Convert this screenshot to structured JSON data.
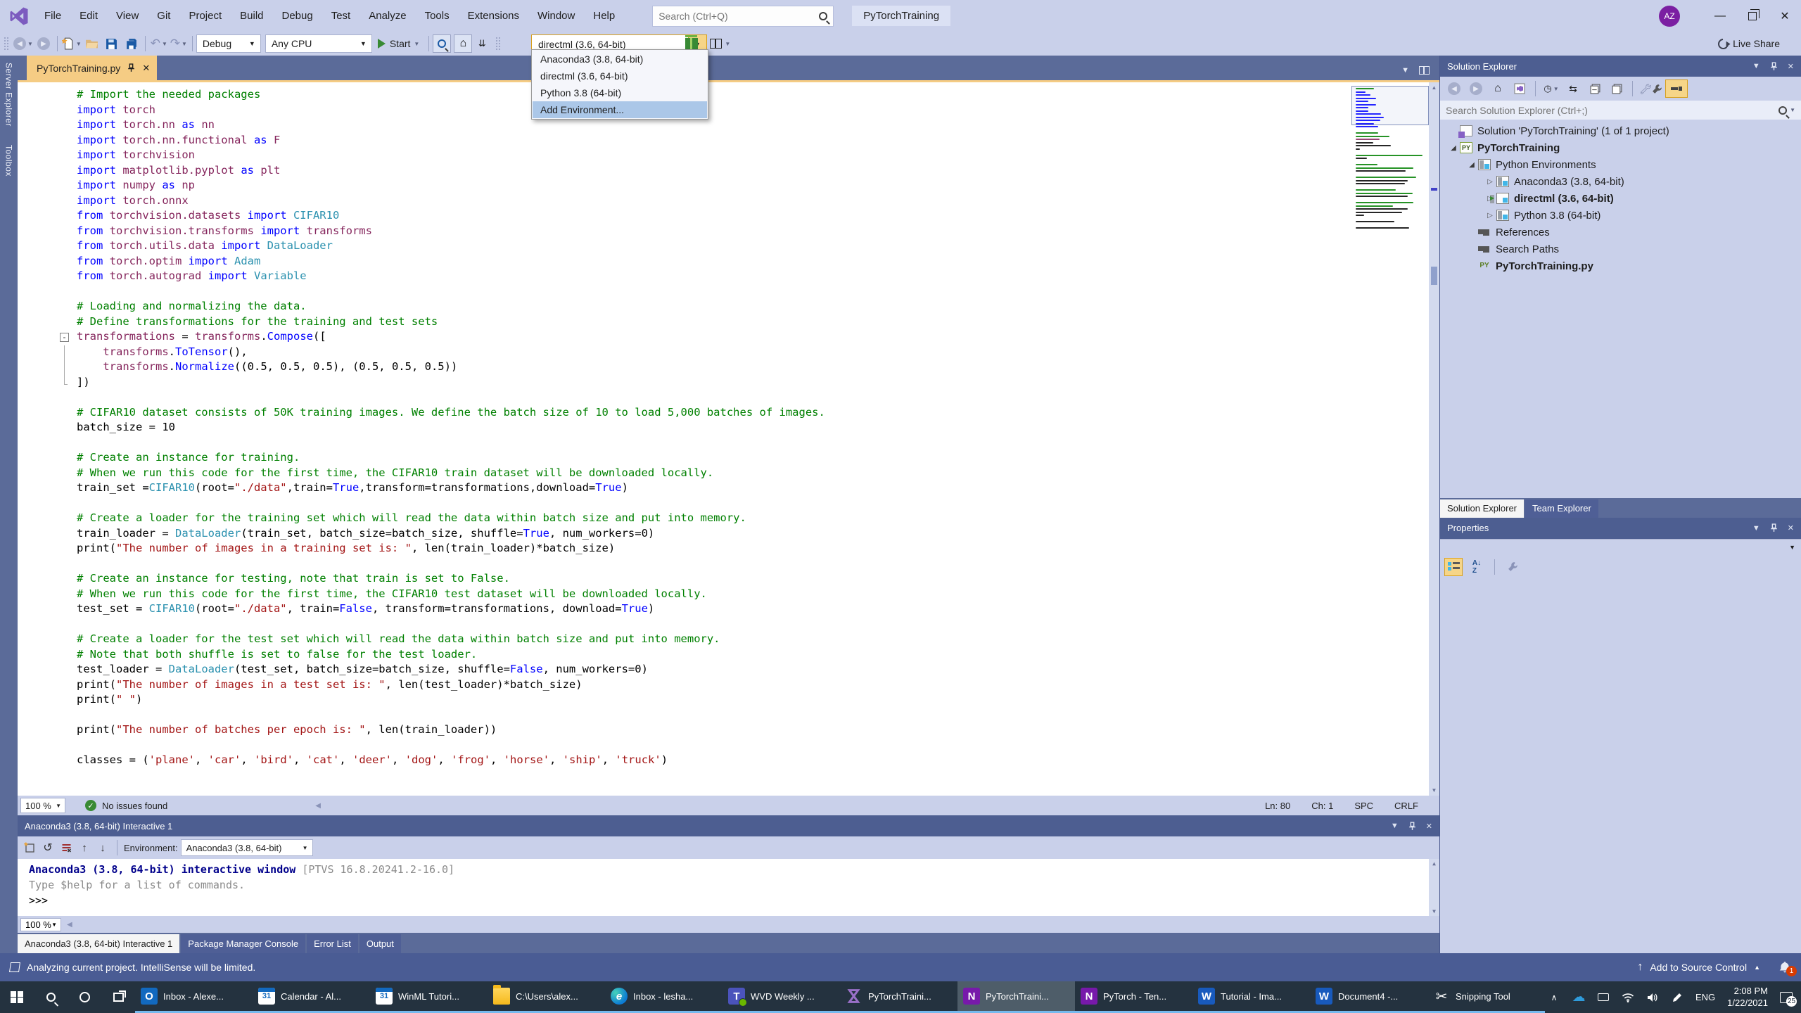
{
  "titlebar": {
    "menus": [
      "File",
      "Edit",
      "View",
      "Git",
      "Project",
      "Build",
      "Debug",
      "Test",
      "Analyze",
      "Tools",
      "Extensions",
      "Window",
      "Help"
    ],
    "search_placeholder": "Search (Ctrl+Q)",
    "window_title": "PyTorchTraining",
    "avatar": "AZ"
  },
  "toolbar": {
    "debug": "Debug",
    "platform": "Any CPU",
    "start": "Start",
    "env_selected": "directml (3.6, 64-bit)",
    "env_options": [
      "Anaconda3 (3.8, 64-bit)",
      "directml (3.6, 64-bit)",
      "Python 3.8 (64-bit)",
      "Add Environment..."
    ],
    "highlighted_option": "Add Environment...",
    "live_share": "Live Share"
  },
  "left_strip": [
    "Server Explorer",
    "Toolbox"
  ],
  "editor": {
    "tab": "PyTorchTraining.py",
    "zoom": "100 %",
    "issues": "No issues found",
    "ln": "Ln: 80",
    "ch": "Ch: 1",
    "spc": "SPC",
    "eol": "CRLF",
    "fold_line": 16,
    "colors": {
      "c": "#008000",
      "k": "#0000ff",
      "m": "#85255c",
      "t": "#2b91af",
      "f": "#0000ff",
      "s": "#a31515",
      "b": "#0000ff",
      "d": "#000000"
    },
    "lines": [
      [
        [
          "c",
          "# Import the needed packages"
        ]
      ],
      [
        [
          "k",
          "import "
        ],
        [
          "m",
          "torch"
        ]
      ],
      [
        [
          "k",
          "import "
        ],
        [
          "m",
          "torch.nn "
        ],
        [
          "k",
          "as "
        ],
        [
          "m",
          "nn"
        ]
      ],
      [
        [
          "k",
          "import "
        ],
        [
          "m",
          "torch.nn.functional "
        ],
        [
          "k",
          "as "
        ],
        [
          "m",
          "F"
        ]
      ],
      [
        [
          "k",
          "import "
        ],
        [
          "m",
          "torchvision"
        ]
      ],
      [
        [
          "k",
          "import "
        ],
        [
          "m",
          "matplotlib.pyplot "
        ],
        [
          "k",
          "as "
        ],
        [
          "m",
          "plt"
        ]
      ],
      [
        [
          "k",
          "import "
        ],
        [
          "m",
          "numpy "
        ],
        [
          "k",
          "as "
        ],
        [
          "m",
          "np"
        ]
      ],
      [
        [
          "k",
          "import "
        ],
        [
          "m",
          "torch.onnx"
        ]
      ],
      [
        [
          "k",
          "from "
        ],
        [
          "m",
          "torchvision.datasets "
        ],
        [
          "k",
          "import "
        ],
        [
          "t",
          "CIFAR10"
        ]
      ],
      [
        [
          "k",
          "from "
        ],
        [
          "m",
          "torchvision.transforms "
        ],
        [
          "k",
          "import "
        ],
        [
          "m",
          "transforms"
        ]
      ],
      [
        [
          "k",
          "from "
        ],
        [
          "m",
          "torch.utils.data "
        ],
        [
          "k",
          "import "
        ],
        [
          "t",
          "DataLoader"
        ]
      ],
      [
        [
          "k",
          "from "
        ],
        [
          "m",
          "torch.optim "
        ],
        [
          "k",
          "import "
        ],
        [
          "t",
          "Adam"
        ]
      ],
      [
        [
          "k",
          "from "
        ],
        [
          "m",
          "torch.autograd "
        ],
        [
          "k",
          "import "
        ],
        [
          "t",
          "Variable"
        ]
      ],
      [],
      [
        [
          "c",
          "# Loading and normalizing the data."
        ]
      ],
      [
        [
          "c",
          "# Define transformations for the training and test sets"
        ]
      ],
      [
        [
          "m",
          "transformations "
        ],
        [
          "d",
          "= "
        ],
        [
          "m",
          "transforms"
        ],
        [
          "d",
          "."
        ],
        [
          "f",
          "Compose"
        ],
        [
          "d",
          "(["
        ]
      ],
      [
        [
          "d",
          "    "
        ],
        [
          "m",
          "transforms"
        ],
        [
          "d",
          "."
        ],
        [
          "f",
          "ToTensor"
        ],
        [
          "d",
          "(),"
        ]
      ],
      [
        [
          "d",
          "    "
        ],
        [
          "m",
          "transforms"
        ],
        [
          "d",
          "."
        ],
        [
          "f",
          "Normalize"
        ],
        [
          "d",
          "((0.5, 0.5, 0.5), (0.5, 0.5, 0.5))"
        ]
      ],
      [
        [
          "d",
          "])"
        ]
      ],
      [],
      [
        [
          "c",
          "# CIFAR10 dataset consists of 50K training images. We define the batch size of 10 to load 5,000 batches of images."
        ]
      ],
      [
        [
          "d",
          "batch_size = 10"
        ]
      ],
      [],
      [
        [
          "c",
          "# Create an instance for training."
        ]
      ],
      [
        [
          "c",
          "# When we run this code for the first time, the CIFAR10 train dataset will be downloaded locally."
        ]
      ],
      [
        [
          "d",
          "train_set ="
        ],
        [
          "t",
          "CIFAR10"
        ],
        [
          "d",
          "(root="
        ],
        [
          "s",
          "\"./data\""
        ],
        [
          "d",
          ",train="
        ],
        [
          "b",
          "True"
        ],
        [
          "d",
          ",transform=transformations,download="
        ],
        [
          "b",
          "True"
        ],
        [
          "d",
          ")"
        ]
      ],
      [],
      [
        [
          "c",
          "# Create a loader for the training set which will read the data within batch size and put into memory."
        ]
      ],
      [
        [
          "d",
          "train_loader = "
        ],
        [
          "t",
          "DataLoader"
        ],
        [
          "d",
          "(train_set, batch_size=batch_size, shuffle="
        ],
        [
          "b",
          "True"
        ],
        [
          "d",
          ", num_workers=0)"
        ]
      ],
      [
        [
          "d",
          "print("
        ],
        [
          "s",
          "\"The number of images in a training set is: \""
        ],
        [
          "d",
          ", len(train_loader)*batch_size)"
        ]
      ],
      [],
      [
        [
          "c",
          "# Create an instance for testing, note that train is set to False."
        ]
      ],
      [
        [
          "c",
          "# When we run this code for the first time, the CIFAR10 test dataset will be downloaded locally."
        ]
      ],
      [
        [
          "d",
          "test_set = "
        ],
        [
          "t",
          "CIFAR10"
        ],
        [
          "d",
          "(root="
        ],
        [
          "s",
          "\"./data\""
        ],
        [
          "d",
          ", train="
        ],
        [
          "b",
          "False"
        ],
        [
          "d",
          ", transform=transformations, download="
        ],
        [
          "b",
          "True"
        ],
        [
          "d",
          ")"
        ]
      ],
      [],
      [
        [
          "c",
          "# Create a loader for the test set which will read the data within batch size and put into memory."
        ]
      ],
      [
        [
          "c",
          "# Note that both shuffle is set to false for the test loader."
        ]
      ],
      [
        [
          "d",
          "test_loader = "
        ],
        [
          "t",
          "DataLoader"
        ],
        [
          "d",
          "(test_set, batch_size=batch_size, shuffle="
        ],
        [
          "b",
          "False"
        ],
        [
          "d",
          ", num_workers=0)"
        ]
      ],
      [
        [
          "d",
          "print("
        ],
        [
          "s",
          "\"The number of images in a test set is: \""
        ],
        [
          "d",
          ", len(test_loader)*batch_size)"
        ]
      ],
      [
        [
          "d",
          "print("
        ],
        [
          "s",
          "\" \""
        ],
        [
          "d",
          ")"
        ]
      ],
      [],
      [
        [
          "d",
          "print("
        ],
        [
          "s",
          "\"The number of batches per epoch is: \""
        ],
        [
          "d",
          ", len(train_loader))"
        ]
      ],
      [],
      [
        [
          "d",
          "classes = ("
        ],
        [
          "s",
          "'plane'"
        ],
        [
          "d",
          ", "
        ],
        [
          "s",
          "'car'"
        ],
        [
          "d",
          ", "
        ],
        [
          "s",
          "'bird'"
        ],
        [
          "d",
          ", "
        ],
        [
          "s",
          "'cat'"
        ],
        [
          "d",
          ", "
        ],
        [
          "s",
          "'deer'"
        ],
        [
          "d",
          ", "
        ],
        [
          "s",
          "'dog'"
        ],
        [
          "d",
          ", "
        ],
        [
          "s",
          "'frog'"
        ],
        [
          "d",
          ", "
        ],
        [
          "s",
          "'horse'"
        ],
        [
          "d",
          ", "
        ],
        [
          "s",
          "'ship'"
        ],
        [
          "d",
          ", "
        ],
        [
          "s",
          "'truck'"
        ],
        [
          "d",
          ")"
        ]
      ]
    ]
  },
  "interactive": {
    "title": "Anaconda3 (3.8, 64-bit) Interactive 1",
    "env_label": "Environment:",
    "env_value": "Anaconda3 (3.8, 64-bit)",
    "banner_bold": "Anaconda3 (3.8, 64-bit) interactive window ",
    "banner_rest": "[PTVS 16.8.20241.2-16.0]",
    "help_line": "Type $help for a list of commands.",
    "prompt": ">>>",
    "zoom": "100 %",
    "tabs": [
      {
        "label": "Anaconda3 (3.8, 64-bit) Interactive 1",
        "active": true
      },
      {
        "label": "Package Manager Console"
      },
      {
        "label": "Error List"
      },
      {
        "label": "Output"
      }
    ]
  },
  "solution_explorer": {
    "title": "Solution Explorer",
    "search_placeholder": "Search Solution Explorer (Ctrl+;)",
    "tree": [
      {
        "indent": 0,
        "icon": "solution",
        "label": "Solution 'PyTorchTraining' (1 of 1 project)"
      },
      {
        "indent": 0,
        "expander": "open",
        "icon": "pyproj",
        "label": "PyTorchTraining",
        "bold": true
      },
      {
        "indent": 1,
        "expander": "open",
        "icon": "envgroup",
        "label": "Python Environments"
      },
      {
        "indent": 2,
        "expander": "closed",
        "icon": "env",
        "label": "Anaconda3 (3.8, 64-bit)"
      },
      {
        "indent": 2,
        "expander": "closed",
        "icon": "env-active",
        "label": "directml (3.6, 64-bit)",
        "bold": true
      },
      {
        "indent": 2,
        "expander": "closed",
        "icon": "env",
        "label": "Python 3.8 (64-bit)"
      },
      {
        "indent": 1,
        "icon": "refs",
        "label": "References"
      },
      {
        "indent": 1,
        "icon": "refs",
        "label": "Search Paths"
      },
      {
        "indent": 1,
        "icon": "pyfile",
        "label": "PyTorchTraining.py",
        "bold": true
      }
    ],
    "tabs": [
      {
        "label": "Solution Explorer",
        "active": true
      },
      {
        "label": "Team Explorer"
      }
    ]
  },
  "properties": {
    "title": "Properties"
  },
  "status_bar": {
    "message": "Analyzing current project. IntelliSense will be limited.",
    "source_control": "Add to Source Control",
    "bell_badge": "1"
  },
  "taskbar": {
    "apps": [
      {
        "icon": "outlook",
        "label": "Inbox - Alexe..."
      },
      {
        "icon": "calendar",
        "label": "Calendar - Al..."
      },
      {
        "icon": "calendar",
        "label": "WinML Tutori..."
      },
      {
        "icon": "folder",
        "label": "C:\\Users\\alex..."
      },
      {
        "icon": "edge",
        "label": "Inbox - lesha..."
      },
      {
        "icon": "teams",
        "label": "WVD Weekly ..."
      },
      {
        "icon": "visual-studio",
        "label": "PyTorchTraini..."
      },
      {
        "icon": "onenote",
        "label": "PyTorchTraini...",
        "active": true
      },
      {
        "icon": "onenote",
        "label": "PyTorch - Ten..."
      },
      {
        "icon": "word",
        "label": "Tutorial - Ima..."
      },
      {
        "icon": "word",
        "label": "Document4 -..."
      },
      {
        "icon": "snipping",
        "label": "Snipping Tool"
      }
    ],
    "tray": {
      "lang": "ENG",
      "time": "2:08 PM",
      "date": "1/22/2021",
      "badge": "25"
    }
  }
}
